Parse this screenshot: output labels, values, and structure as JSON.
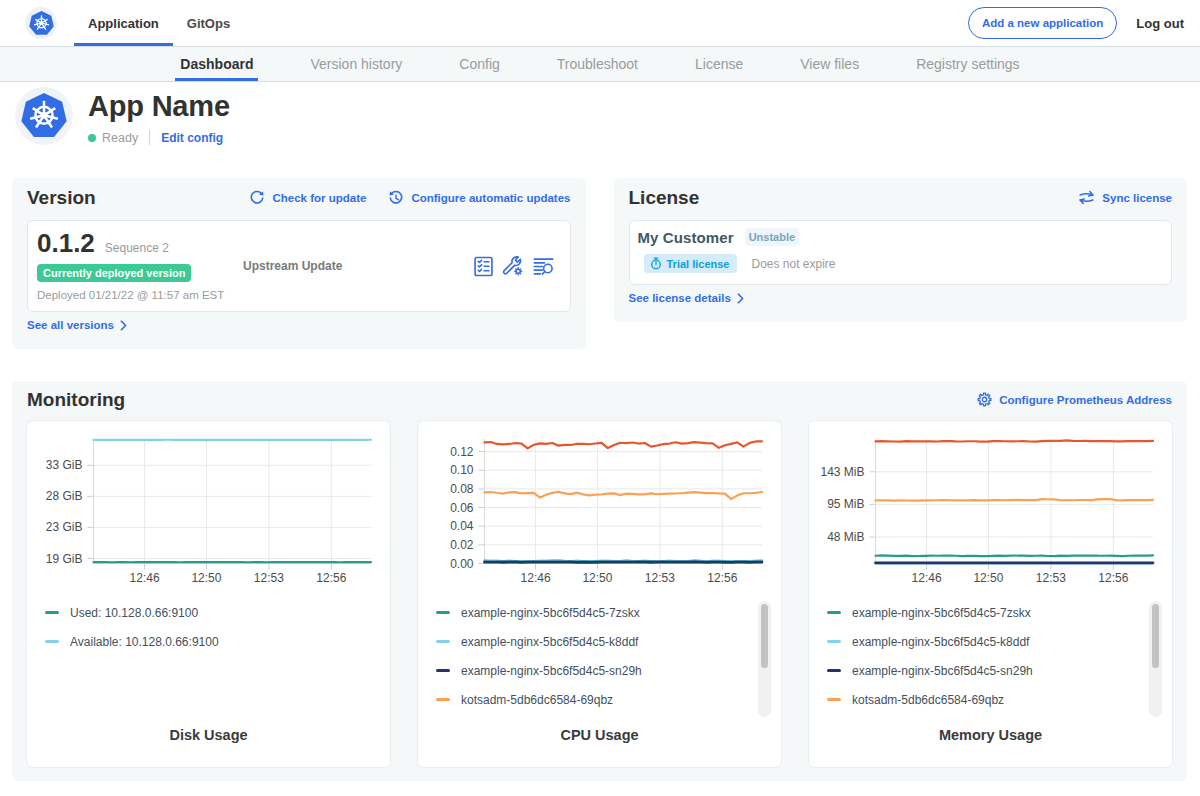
{
  "navbar": {
    "tabs": [
      {
        "label": "Application",
        "active": true
      },
      {
        "label": "GitOps",
        "active": false
      }
    ],
    "add_app_button": "Add a new application",
    "logout_label": "Log out"
  },
  "subnav": {
    "items": [
      {
        "label": "Dashboard",
        "active": true
      },
      {
        "label": "Version history",
        "active": false
      },
      {
        "label": "Config",
        "active": false
      },
      {
        "label": "Troubleshoot",
        "active": false
      },
      {
        "label": "License",
        "active": false
      },
      {
        "label": "View files",
        "active": false
      },
      {
        "label": "Registry settings",
        "active": false
      }
    ]
  },
  "app_header": {
    "title": "App Name",
    "status": "Ready",
    "edit_config_label": "Edit config"
  },
  "version_card": {
    "title": "Version",
    "check_update_label": "Check for update",
    "auto_updates_label": "Configure automatic updates",
    "version_number": "0.1.2",
    "sequence": "Sequence 2",
    "deployed_badge": "Currently deployed version",
    "deployed_text": "Deployed 01/21/22 @ 11:57 am EST",
    "source": "Upstream Update",
    "see_all_label": "See all versions"
  },
  "license_card": {
    "title": "License",
    "sync_label": "Sync license",
    "customer_name": "My Customer",
    "channel_badge": "Unstable",
    "type_badge": "Trial license",
    "expiration": "Does not expire",
    "details_label": "See license details"
  },
  "monitoring": {
    "title": "Monitoring",
    "configure_label": "Configure Prometheus Address"
  },
  "colors": {
    "accent_blue": "#326de6",
    "success_green": "#3dc995",
    "teal": "#299a93",
    "light_blue": "#83d2ea",
    "navy": "#21356d",
    "orange": "#fba252",
    "red_orange": "#e8562d"
  },
  "chart_data": [
    {
      "type": "line",
      "title": "Disk Usage",
      "x_ticks": [
        {
          "label": "12:46",
          "frac": 0.184
        },
        {
          "label": "12:50",
          "frac": 0.407
        },
        {
          "label": "12:53",
          "frac": 0.632
        },
        {
          "label": "12:56",
          "frac": 0.857
        }
      ],
      "y_ticks": [
        {
          "value": 19,
          "label": "19 GiB"
        },
        {
          "value": 23.667,
          "label": "23 GiB"
        },
        {
          "value": 28.333,
          "label": "28 GiB"
        },
        {
          "value": 33,
          "label": "33 GiB"
        }
      ],
      "ylim": [
        18.25,
        36.95
      ],
      "series": [
        {
          "name": "Used: 10.128.0.66:9100",
          "color": "#299a93",
          "width": 2.2,
          "values": [
            18.453,
            18.453,
            18.451,
            18.435,
            18.448,
            18.446,
            18.434,
            18.444,
            18.448,
            18.455,
            18.443,
            18.448,
            18.458,
            18.456,
            18.437,
            18.443,
            18.451,
            18.449,
            18.444,
            18.452,
            18.463,
            18.443,
            18.46,
            18.457,
            18.447,
            18.438,
            18.445,
            18.455,
            18.436,
            18.442,
            18.454,
            18.452,
            18.45,
            18.446,
            18.453,
            18.45,
            18.449,
            18.447,
            18.447,
            18.444,
            18.439,
            18.446,
            18.459,
            18.452,
            18.448,
            18.462
          ]
        },
        {
          "name": "Available: 10.128.0.66:9100",
          "color": "#83d2ea",
          "width": 2.2,
          "values": [
            36.826,
            36.835,
            36.823,
            36.809,
            36.825,
            36.812,
            36.81,
            36.818,
            36.819,
            36.826,
            36.813,
            36.828,
            36.834,
            36.822,
            36.819,
            36.814,
            36.822,
            36.813,
            36.814,
            36.823,
            36.831,
            36.828,
            36.824,
            36.833,
            36.816,
            36.818,
            36.82,
            36.828,
            36.817,
            36.807,
            36.82,
            36.827,
            36.812,
            36.823,
            36.825,
            36.819,
            36.809,
            36.823,
            36.814,
            36.808,
            36.808,
            36.826,
            36.817,
            36.818,
            36.823,
            36.837
          ]
        }
      ],
      "legend": [
        {
          "label": "Used: 10.128.0.66:9100",
          "color": "#299a93"
        },
        {
          "label": "Available: 10.128.0.66:9100",
          "color": "#83d2ea"
        }
      ],
      "scrollbar": false
    },
    {
      "type": "line",
      "title": "CPU Usage",
      "x_ticks": [
        {
          "label": "12:46",
          "frac": 0.184
        },
        {
          "label": "12:50",
          "frac": 0.407
        },
        {
          "label": "12:53",
          "frac": 0.632
        },
        {
          "label": "12:56",
          "frac": 0.857
        }
      ],
      "y_ticks": [
        {
          "value": 0,
          "label": "0.00"
        },
        {
          "value": 0.02,
          "label": "0.02"
        },
        {
          "value": 0.04,
          "label": "0.04"
        },
        {
          "value": 0.06,
          "label": "0.06"
        },
        {
          "value": 0.08,
          "label": "0.08"
        },
        {
          "value": 0.1,
          "label": "0.10"
        },
        {
          "value": 0.12,
          "label": "0.12"
        }
      ],
      "ylim": [
        0,
        0.1335
      ],
      "series": [
        {
          "name": "example-nginx-5bc6f5d4c5-7zskx",
          "color": "#299a93",
          "width": 2,
          "values": [
            0.00315,
            0.003,
            0.00296,
            0.00281,
            0.00293,
            0.00269,
            0.00245,
            0.00253,
            0.00281,
            0.00282,
            0.00287,
            0.00311,
            0.00321,
            0.00282,
            0.00269,
            0.00286,
            0.00258,
            0.00264,
            0.00278,
            0.00301,
            0.00305,
            0.0028,
            0.00278,
            0.0032,
            0.00281,
            0.00279,
            0.00295,
            0.00274,
            0.00253,
            0.00276,
            0.00294,
            0.00278,
            0.00263,
            0.00274,
            0.00326,
            0.00307,
            0.00253,
            0.0029,
            0.00302,
            0.00267,
            0.00246,
            0.00281,
            0.00274,
            0.00256,
            0.00307,
            0.00315
          ]
        },
        {
          "name": "example-nginx-5bc6f5d4c5-k8ddf",
          "color": "#83d2ea",
          "width": 2,
          "values": [
            0.00218,
            0.00231,
            0.00207,
            0.00208,
            0.00214,
            0.00201,
            0.00193,
            0.00198,
            0.00211,
            0.0022,
            0.00205,
            0.00215,
            0.00215,
            0.0022,
            0.00198,
            0.00206,
            0.0021,
            0.00207,
            0.00198,
            0.00224,
            0.00217,
            0.00211,
            0.00216,
            0.00213,
            0.00213,
            0.00196,
            0.00196,
            0.00216,
            0.00192,
            0.00197,
            0.00217,
            0.00217,
            0.00206,
            0.00215,
            0.00226,
            0.00223,
            0.00196,
            0.00209,
            0.00205,
            0.00195,
            0.00202,
            0.0021,
            0.00216,
            0.00214,
            0.00222,
            0.00223
          ]
        },
        {
          "name": "kotsadm-5db6dc6584-69qbz",
          "color": "#fba252",
          "width": 2.2,
          "values": [
            0.07631,
            0.07664,
            0.07584,
            0.07495,
            0.07627,
            0.07648,
            0.0752,
            0.07541,
            0.07571,
            0.07074,
            0.07384,
            0.07581,
            0.07687,
            0.07526,
            0.07441,
            0.07593,
            0.07415,
            0.07311,
            0.07378,
            0.07403,
            0.0749,
            0.07514,
            0.07338,
            0.07499,
            0.07459,
            0.0741,
            0.07415,
            0.07514,
            0.07425,
            0.07458,
            0.07488,
            0.07505,
            0.07549,
            0.07608,
            0.07654,
            0.07608,
            0.07542,
            0.07556,
            0.07511,
            0.0749,
            0.06904,
            0.07302,
            0.07534,
            0.07535,
            0.07564,
            0.07693
          ]
        },
        {
          "name": "",
          "color": "#e8562d",
          "width": 2.2,
          "values": [
            0.12984,
            0.13025,
            0.12819,
            0.12772,
            0.12817,
            0.12918,
            0.12858,
            0.12347,
            0.12729,
            0.12885,
            0.12829,
            0.12922,
            0.12639,
            0.12717,
            0.12711,
            0.12829,
            0.12833,
            0.12789,
            0.12869,
            0.12939,
            0.12379,
            0.12701,
            0.12948,
            0.12902,
            0.12974,
            0.12863,
            0.12923,
            0.12537,
            0.12651,
            0.12794,
            0.12863,
            0.12998,
            0.12854,
            0.12905,
            0.13016,
            0.12955,
            0.12898,
            0.12881,
            0.12404,
            0.12679,
            0.12827,
            0.12986,
            0.1253,
            0.1293,
            0.13086,
            0.13102
          ]
        },
        {
          "name": "example-nginx-5bc6f5d4c5-sn29h",
          "color": "#21356d",
          "width": 2.8,
          "values": [
            0.00147,
            0.00149,
            0.00139,
            0.00135,
            0.00137,
            0.00139,
            0.00131,
            0.00142,
            0.00148,
            0.00152,
            0.00148,
            0.00141,
            0.00151,
            0.00148,
            0.00139,
            0.00131,
            0.00132,
            0.0013,
            0.00125,
            0.00139,
            0.00138,
            0.00143,
            0.00149,
            0.00157,
            0.00137,
            0.00138,
            0.0014,
            0.00134,
            0.00138,
            0.00139,
            0.00137,
            0.00152,
            0.00138,
            0.00143,
            0.00159,
            0.00151,
            0.0013,
            0.00137,
            0.00141,
            0.0013,
            0.00125,
            0.00137,
            0.00147,
            0.00131,
            0.00143,
            0.0015
          ]
        }
      ],
      "legend": [
        {
          "label": "example-nginx-5bc6f5d4c5-7zskx",
          "color": "#299a93"
        },
        {
          "label": "example-nginx-5bc6f5d4c5-k8ddf",
          "color": "#83d2ea"
        },
        {
          "label": "example-nginx-5bc6f5d4c5-sn29h",
          "color": "#21356d"
        },
        {
          "label": "kotsadm-5db6dc6584-69qbz",
          "color": "#fba252"
        }
      ],
      "scrollbar": true
    },
    {
      "type": "line",
      "title": "Memory Usage",
      "x_ticks": [
        {
          "label": "12:46",
          "frac": 0.184
        },
        {
          "label": "12:50",
          "frac": 0.407
        },
        {
          "label": "12:53",
          "frac": 0.632
        },
        {
          "label": "12:56",
          "frac": 0.857
        }
      ],
      "y_ticks": [
        {
          "value": 47.7,
          "label": "48 MiB"
        },
        {
          "value": 95.4,
          "label": "95 MiB"
        },
        {
          "value": 143.1,
          "label": "143 MiB"
        }
      ],
      "ylim": [
        9,
        191
      ],
      "series": [
        {
          "name": "example-nginx-5bc6f5d4c5-k8ddf",
          "color": "#83d2ea",
          "width": 2,
          "values": [
            9.04,
            9.08,
            9.01,
            8.98,
            8.96,
            8.95,
            8.92,
            8.96,
            8.99,
            9.06,
            9.01,
            9.04,
            9.06,
            9.02,
            8.96,
            8.94,
            9.02,
            8.98,
            8.96,
            9.02,
            9.04,
            8.96,
            9.04,
            9.03,
            8.98,
            8.95,
            9.01,
            8.97,
            8.98,
            8.99,
            9.01,
            9.01,
            9.0,
            9.03,
            9.08,
            9.04,
            8.99,
            8.95,
            8.97,
            8.94,
            8.97,
            8.98,
            9.03,
            8.95,
            8.97,
            9.04
          ]
        },
        {
          "name": "example-nginx-5bc6f5d4c5-7zskx",
          "color": "#299a93",
          "width": 2.2,
          "values": [
            20.36,
            20.89,
            20.55,
            20.04,
            20.05,
            20.52,
            19.87,
            20.0,
            20.19,
            20.44,
            20.31,
            20.49,
            20.47,
            20.34,
            19.75,
            20.06,
            20.01,
            19.92,
            19.75,
            20.13,
            20.38,
            20.15,
            20.51,
            20.7,
            20.57,
            20.19,
            20.35,
            20.51,
            19.93,
            19.86,
            20.65,
            20.26,
            20.42,
            20.52,
            20.42,
            20.69,
            20.39,
            20.31,
            20.46,
            20.21,
            19.71,
            20.3,
            20.44,
            20.47,
            20.57,
            20.89
          ]
        },
        {
          "name": "kotsadm-5db6dc6584-69qbz",
          "color": "#fba252",
          "width": 2.2,
          "values": [
            101.26,
            101.36,
            101.31,
            100.94,
            101.18,
            101.08,
            100.98,
            100.93,
            101.34,
            101.26,
            101.45,
            101.51,
            101.48,
            101.39,
            101.4,
            101.16,
            101.52,
            101.16,
            101.24,
            101.69,
            101.56,
            101.49,
            101.69,
            102.0,
            101.53,
            101.53,
            101.58,
            103.21,
            102.91,
            102.88,
            101.44,
            101.57,
            101.43,
            101.84,
            101.83,
            101.65,
            102.79,
            103.2,
            103.28,
            101.59,
            101.37,
            101.62,
            101.77,
            101.73,
            101.7,
            102.06
          ]
        },
        {
          "name": "",
          "color": "#e8562d",
          "width": 2.2,
          "values": [
            187.52,
            187.79,
            187.63,
            187.35,
            187.27,
            187.81,
            187.47,
            187.67,
            187.56,
            187.66,
            187.37,
            187.92,
            187.8,
            187.43,
            187.33,
            187.74,
            187.73,
            187.18,
            187.16,
            187.94,
            187.82,
            187.72,
            187.52,
            187.7,
            187.81,
            187.38,
            187.29,
            187.82,
            188.22,
            188.32,
            188.31,
            188.86,
            188.3,
            188.09,
            188.14,
            187.91,
            187.75,
            188.07,
            187.8,
            187.49,
            187.65,
            187.85,
            187.94,
            187.84,
            187.92,
            188.31
          ]
        },
        {
          "name": "example-nginx-5bc6f5d4c5-sn29h",
          "color": "#21356d",
          "width": 2.8,
          "values": [
            9.94,
            9.95,
            9.91,
            9.85,
            9.89,
            9.89,
            9.86,
            9.84,
            9.95,
            9.9,
            9.94,
            9.96,
            9.91,
            9.9,
            9.89,
            9.92,
            9.89,
            9.84,
            9.84,
            9.95,
            9.9,
            9.91,
            9.89,
            9.95,
            9.95,
            9.85,
            9.91,
            9.9,
            9.89,
            9.87,
            9.89,
            9.95,
            9.9,
            9.88,
            9.91,
            9.92,
            9.88,
            9.88,
            9.87,
            9.85,
            9.84,
            9.92,
            9.88,
            9.91,
            9.94,
            9.92
          ]
        }
      ],
      "legend": [
        {
          "label": "example-nginx-5bc6f5d4c5-7zskx",
          "color": "#299a93"
        },
        {
          "label": "example-nginx-5bc6f5d4c5-k8ddf",
          "color": "#83d2ea"
        },
        {
          "label": "example-nginx-5bc6f5d4c5-sn29h",
          "color": "#21356d"
        },
        {
          "label": "kotsadm-5db6dc6584-69qbz",
          "color": "#fba252"
        }
      ],
      "scrollbar": true
    }
  ]
}
